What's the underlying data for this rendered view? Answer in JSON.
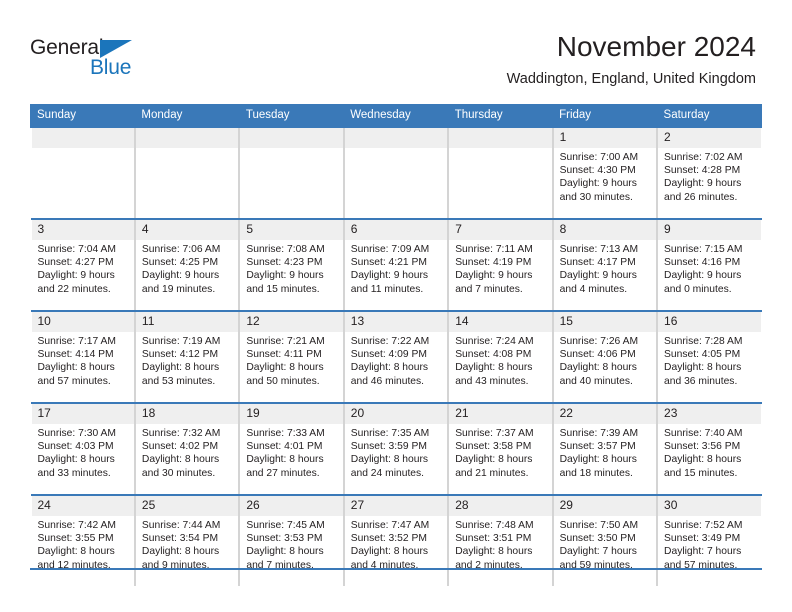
{
  "brand": {
    "name_part1": "General",
    "name_part2": "Blue",
    "accent_color": "#1b75bb"
  },
  "header": {
    "title": "November 2024",
    "subtitle": "Waddington, England, United Kingdom"
  },
  "theme": {
    "header_blue": "#3a79b8",
    "daynum_bg": "#efefef",
    "text": "#231f20"
  },
  "calendar": {
    "weekday_headers": [
      "Sunday",
      "Monday",
      "Tuesday",
      "Wednesday",
      "Thursday",
      "Friday",
      "Saturday"
    ],
    "weeks": [
      [
        {
          "day": "",
          "lines": []
        },
        {
          "day": "",
          "lines": []
        },
        {
          "day": "",
          "lines": []
        },
        {
          "day": "",
          "lines": []
        },
        {
          "day": "",
          "lines": []
        },
        {
          "day": "1",
          "lines": [
            "Sunrise: 7:00 AM",
            "Sunset: 4:30 PM",
            "Daylight: 9 hours",
            "and 30 minutes."
          ]
        },
        {
          "day": "2",
          "lines": [
            "Sunrise: 7:02 AM",
            "Sunset: 4:28 PM",
            "Daylight: 9 hours",
            "and 26 minutes."
          ]
        }
      ],
      [
        {
          "day": "3",
          "lines": [
            "Sunrise: 7:04 AM",
            "Sunset: 4:27 PM",
            "Daylight: 9 hours",
            "and 22 minutes."
          ]
        },
        {
          "day": "4",
          "lines": [
            "Sunrise: 7:06 AM",
            "Sunset: 4:25 PM",
            "Daylight: 9 hours",
            "and 19 minutes."
          ]
        },
        {
          "day": "5",
          "lines": [
            "Sunrise: 7:08 AM",
            "Sunset: 4:23 PM",
            "Daylight: 9 hours",
            "and 15 minutes."
          ]
        },
        {
          "day": "6",
          "lines": [
            "Sunrise: 7:09 AM",
            "Sunset: 4:21 PM",
            "Daylight: 9 hours",
            "and 11 minutes."
          ]
        },
        {
          "day": "7",
          "lines": [
            "Sunrise: 7:11 AM",
            "Sunset: 4:19 PM",
            "Daylight: 9 hours",
            "and 7 minutes."
          ]
        },
        {
          "day": "8",
          "lines": [
            "Sunrise: 7:13 AM",
            "Sunset: 4:17 PM",
            "Daylight: 9 hours",
            "and 4 minutes."
          ]
        },
        {
          "day": "9",
          "lines": [
            "Sunrise: 7:15 AM",
            "Sunset: 4:16 PM",
            "Daylight: 9 hours",
            "and 0 minutes."
          ]
        }
      ],
      [
        {
          "day": "10",
          "lines": [
            "Sunrise: 7:17 AM",
            "Sunset: 4:14 PM",
            "Daylight: 8 hours",
            "and 57 minutes."
          ]
        },
        {
          "day": "11",
          "lines": [
            "Sunrise: 7:19 AM",
            "Sunset: 4:12 PM",
            "Daylight: 8 hours",
            "and 53 minutes."
          ]
        },
        {
          "day": "12",
          "lines": [
            "Sunrise: 7:21 AM",
            "Sunset: 4:11 PM",
            "Daylight: 8 hours",
            "and 50 minutes."
          ]
        },
        {
          "day": "13",
          "lines": [
            "Sunrise: 7:22 AM",
            "Sunset: 4:09 PM",
            "Daylight: 8 hours",
            "and 46 minutes."
          ]
        },
        {
          "day": "14",
          "lines": [
            "Sunrise: 7:24 AM",
            "Sunset: 4:08 PM",
            "Daylight: 8 hours",
            "and 43 minutes."
          ]
        },
        {
          "day": "15",
          "lines": [
            "Sunrise: 7:26 AM",
            "Sunset: 4:06 PM",
            "Daylight: 8 hours",
            "and 40 minutes."
          ]
        },
        {
          "day": "16",
          "lines": [
            "Sunrise: 7:28 AM",
            "Sunset: 4:05 PM",
            "Daylight: 8 hours",
            "and 36 minutes."
          ]
        }
      ],
      [
        {
          "day": "17",
          "lines": [
            "Sunrise: 7:30 AM",
            "Sunset: 4:03 PM",
            "Daylight: 8 hours",
            "and 33 minutes."
          ]
        },
        {
          "day": "18",
          "lines": [
            "Sunrise: 7:32 AM",
            "Sunset: 4:02 PM",
            "Daylight: 8 hours",
            "and 30 minutes."
          ]
        },
        {
          "day": "19",
          "lines": [
            "Sunrise: 7:33 AM",
            "Sunset: 4:01 PM",
            "Daylight: 8 hours",
            "and 27 minutes."
          ]
        },
        {
          "day": "20",
          "lines": [
            "Sunrise: 7:35 AM",
            "Sunset: 3:59 PM",
            "Daylight: 8 hours",
            "and 24 minutes."
          ]
        },
        {
          "day": "21",
          "lines": [
            "Sunrise: 7:37 AM",
            "Sunset: 3:58 PM",
            "Daylight: 8 hours",
            "and 21 minutes."
          ]
        },
        {
          "day": "22",
          "lines": [
            "Sunrise: 7:39 AM",
            "Sunset: 3:57 PM",
            "Daylight: 8 hours",
            "and 18 minutes."
          ]
        },
        {
          "day": "23",
          "lines": [
            "Sunrise: 7:40 AM",
            "Sunset: 3:56 PM",
            "Daylight: 8 hours",
            "and 15 minutes."
          ]
        }
      ],
      [
        {
          "day": "24",
          "lines": [
            "Sunrise: 7:42 AM",
            "Sunset: 3:55 PM",
            "Daylight: 8 hours",
            "and 12 minutes."
          ]
        },
        {
          "day": "25",
          "lines": [
            "Sunrise: 7:44 AM",
            "Sunset: 3:54 PM",
            "Daylight: 8 hours",
            "and 9 minutes."
          ]
        },
        {
          "day": "26",
          "lines": [
            "Sunrise: 7:45 AM",
            "Sunset: 3:53 PM",
            "Daylight: 8 hours",
            "and 7 minutes."
          ]
        },
        {
          "day": "27",
          "lines": [
            "Sunrise: 7:47 AM",
            "Sunset: 3:52 PM",
            "Daylight: 8 hours",
            "and 4 minutes."
          ]
        },
        {
          "day": "28",
          "lines": [
            "Sunrise: 7:48 AM",
            "Sunset: 3:51 PM",
            "Daylight: 8 hours",
            "and 2 minutes."
          ]
        },
        {
          "day": "29",
          "lines": [
            "Sunrise: 7:50 AM",
            "Sunset: 3:50 PM",
            "Daylight: 7 hours",
            "and 59 minutes."
          ]
        },
        {
          "day": "30",
          "lines": [
            "Sunrise: 7:52 AM",
            "Sunset: 3:49 PM",
            "Daylight: 7 hours",
            "and 57 minutes."
          ]
        }
      ]
    ]
  }
}
